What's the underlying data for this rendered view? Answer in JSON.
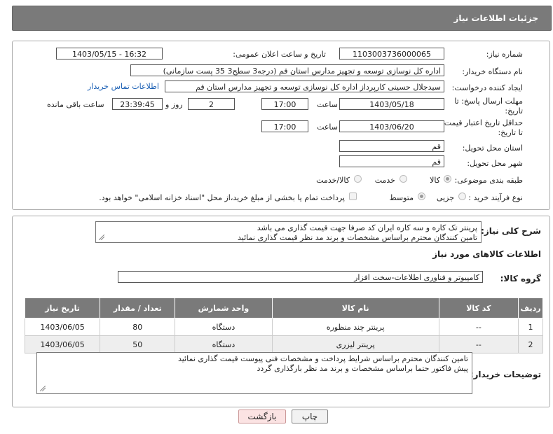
{
  "header": {
    "title": "جزئیات اطلاعات نیاز"
  },
  "form": {
    "need_number_label": "شماره نیاز:",
    "need_number": "1103003736000065",
    "announce_label": "تاریخ و ساعت اعلان عمومی:",
    "announce_value": "1403/05/15 - 16:32",
    "buyer_org_label": "نام دستگاه خریدار:",
    "buyer_org": "اداره کل نوسازی   توسعه و تجهیز مدارس استان قم (درجه3 سطح3  35 پست سازمانی)",
    "creator_label": "ایجاد کننده درخواست:",
    "creator": "سیدجلال حسینی کارپرداز اداره کل نوسازی   توسعه و تجهیز مدارس استان قم",
    "contact_link": "اطلاعات تماس خریدار",
    "deadline_label": "مهلت ارسال پاسخ: تا تاریخ:",
    "deadline_date": "1403/05/18",
    "time_label": "ساعت",
    "deadline_time": "17:00",
    "days_label": "روز و",
    "days_value": "2",
    "remaining_time": "23:39:45",
    "remaining_label": "ساعت باقی مانده",
    "validity_label": "حداقل تاریخ اعتبار قیمت: تا تاریخ:",
    "validity_date": "1403/06/20",
    "validity_time": "17:00",
    "province_label": "استان محل تحویل:",
    "province": "قم",
    "city_label": "شهر محل تحویل:",
    "city": "قم",
    "category_label": "طبقه بندی موضوعی:",
    "category_options": [
      "کالا",
      "خدمت",
      "کالا/خدمت"
    ],
    "purchase_type_label": "نوع فرآیند خرید :",
    "purchase_options": [
      "جزیی",
      "متوسط"
    ],
    "payment_note": "پرداخت تمام یا بخشی از مبلغ خرید،از محل \"اسناد خزانه اسلامی\" خواهد بود."
  },
  "needs": {
    "summary_label": "شرح کلی نیاز:",
    "summary_line1": "پرینتر تک کاره و سه کاره  ایران کد صرفا جهت قیمت گذاری می باشد",
    "summary_line2": "تامین کنندگان محترم براساس مشخصات و برند مد نظر قیمت گذاری نمائید",
    "items_info_title": "اطلاعات کالاهای مورد نیاز",
    "group_label": "گروه کالا:",
    "group_value": "کامپیوتر و فناوری اطلاعات-سخت افزار",
    "table": {
      "headers": [
        "ردیف",
        "کد کالا",
        "نام کالا",
        "واحد شمارش",
        "تعداد / مقدار",
        "تاریخ نیاز"
      ],
      "rows": [
        [
          "1",
          "--",
          "پرینتر چند منظوره",
          "دستگاه",
          "80",
          "1403/06/05"
        ],
        [
          "2",
          "--",
          "پرینتر لیزری",
          "دستگاه",
          "50",
          "1403/06/05"
        ]
      ]
    },
    "buyer_notes_label": "توضیحات خریدار:",
    "buyer_notes_line1": "تامین کنندگان محترم براساس شرایط پرداخت و مشخصات فنی پیوست قیمت گذاری نمائید",
    "buyer_notes_line2": "پیش فاکتور حتما براساس مشخصات و برند مد نظر بارگذاری گردد"
  },
  "buttons": {
    "print": "چاپ",
    "back": "بازگشت"
  }
}
